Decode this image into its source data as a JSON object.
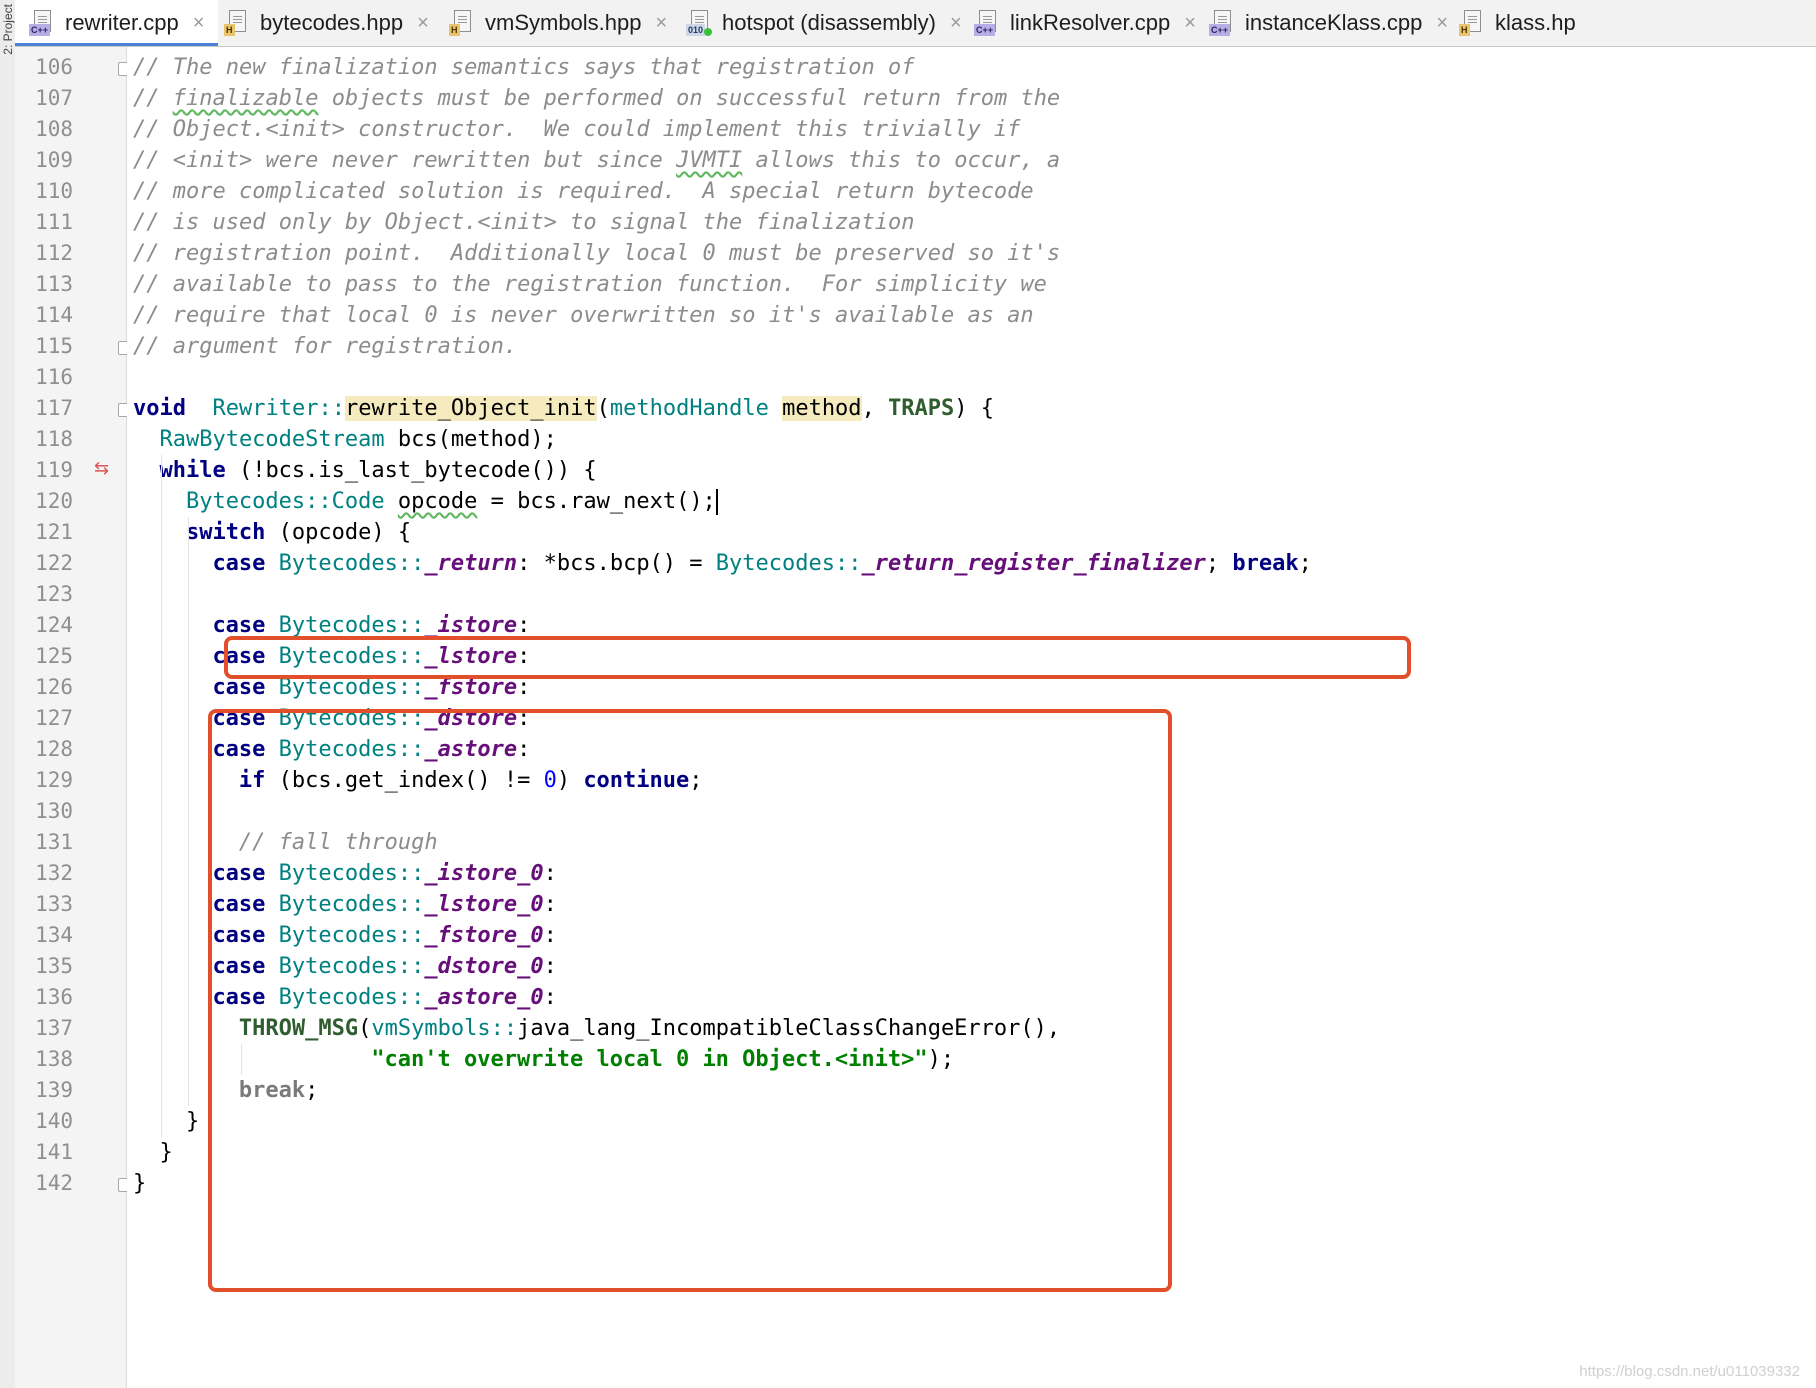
{
  "tabs": [
    {
      "label": "rewriter.cpp",
      "badge": "C++",
      "kind": "cpp",
      "active": true
    },
    {
      "label": "bytecodes.hpp",
      "badge": "H",
      "kind": "h"
    },
    {
      "label": "vmSymbols.hpp",
      "badge": "H",
      "kind": "h"
    },
    {
      "label": "hotspot (disassembly)",
      "badge": "010",
      "kind": "bin"
    },
    {
      "label": "linkResolver.cpp",
      "badge": "C++",
      "kind": "cpp"
    },
    {
      "label": "instanceKlass.cpp",
      "badge": "C++",
      "kind": "cpp"
    },
    {
      "label": "klass.hp",
      "badge": "H",
      "kind": "h"
    }
  ],
  "tab_close_glyph": "×",
  "side_label": "2: Project",
  "current_line": 120,
  "lines": [
    {
      "n": "106",
      "indent": 0,
      "t": [
        [
          "cm",
          "// The new finalization semantics says that registration of"
        ]
      ]
    },
    {
      "n": "107",
      "indent": 0,
      "t": [
        [
          "cm",
          "// "
        ],
        [
          "cm wavy",
          "finalizable"
        ],
        [
          "cm",
          " objects must be performed on successful return from the"
        ]
      ]
    },
    {
      "n": "108",
      "indent": 0,
      "t": [
        [
          "cm",
          "// Object.<init> constructor.  We could implement this trivially if"
        ]
      ]
    },
    {
      "n": "109",
      "indent": 0,
      "t": [
        [
          "cm",
          "// <init> were never rewritten but since "
        ],
        [
          "cm wavy",
          "JVMTI"
        ],
        [
          "cm",
          " allows this to occur, a"
        ]
      ]
    },
    {
      "n": "110",
      "indent": 0,
      "t": [
        [
          "cm",
          "// more complicated solution is required.  A special return bytecode"
        ]
      ]
    },
    {
      "n": "111",
      "indent": 0,
      "t": [
        [
          "cm",
          "// is used only by Object.<init> to signal the finalization"
        ]
      ]
    },
    {
      "n": "112",
      "indent": 0,
      "t": [
        [
          "cm",
          "// registration point.  Additionally local 0 must be preserved so it's"
        ]
      ]
    },
    {
      "n": "113",
      "indent": 0,
      "t": [
        [
          "cm",
          "// available to pass to the registration function.  For simplicity we"
        ]
      ]
    },
    {
      "n": "114",
      "indent": 0,
      "t": [
        [
          "cm",
          "// require that local 0 is never overwritten so it's available as an"
        ]
      ]
    },
    {
      "n": "115",
      "indent": 0,
      "t": [
        [
          "cm",
          "// argument for registration."
        ]
      ]
    },
    {
      "n": "116",
      "indent": 0,
      "t": []
    },
    {
      "n": "117",
      "indent": 0,
      "t": [
        [
          "kw",
          "void"
        ],
        [
          "",
          "  "
        ],
        [
          "ty",
          "Rewriter"
        ],
        [
          "ty",
          "::"
        ],
        [
          "fn",
          "rewrite_Object_init"
        ],
        [
          "",
          "("
        ],
        [
          "ty",
          "methodHandle"
        ],
        [
          "",
          " "
        ],
        [
          "paramhl",
          "method"
        ],
        [
          "",
          ", "
        ],
        [
          "mac",
          "TRAPS"
        ],
        [
          "",
          ") {"
        ]
      ]
    },
    {
      "n": "118",
      "indent": 2,
      "t": [
        [
          "ty",
          "RawBytecodeStream"
        ],
        [
          "",
          " bcs(method);"
        ]
      ]
    },
    {
      "n": "119",
      "indent": 2,
      "t": [
        [
          "kw",
          "while"
        ],
        [
          "",
          " (!bcs.is_last_bytecode()) {"
        ]
      ]
    },
    {
      "n": "120",
      "indent": 4,
      "t": [
        [
          "ty",
          "Bytecodes"
        ],
        [
          "ty",
          "::"
        ],
        [
          "ty",
          "Code"
        ],
        [
          "",
          " "
        ],
        [
          "wavy",
          "opcode"
        ],
        [
          "",
          " = bcs.raw_next();"
        ]
      ]
    },
    {
      "n": "121",
      "indent": 4,
      "t": [
        [
          "kw",
          "switch"
        ],
        [
          "",
          " (opcode) {"
        ]
      ]
    },
    {
      "n": "122",
      "indent": 6,
      "t": [
        [
          "kw",
          "case"
        ],
        [
          "",
          " "
        ],
        [
          "ty",
          "Bytecodes"
        ],
        [
          "ty",
          "::"
        ],
        [
          "en",
          "_return"
        ],
        [
          "",
          ": *bcs.bcp() = "
        ],
        [
          "ty",
          "Bytecodes"
        ],
        [
          "ty",
          "::"
        ],
        [
          "en",
          "_return_register_finalizer"
        ],
        [
          "",
          "; "
        ],
        [
          "kw",
          "break"
        ],
        [
          "",
          ";"
        ]
      ]
    },
    {
      "n": "123",
      "indent": 0,
      "t": []
    },
    {
      "n": "124",
      "indent": 6,
      "t": [
        [
          "kw",
          "case"
        ],
        [
          "",
          " "
        ],
        [
          "ty",
          "Bytecodes"
        ],
        [
          "ty",
          "::"
        ],
        [
          "en",
          "_istore"
        ],
        [
          "",
          ":"
        ]
      ]
    },
    {
      "n": "125",
      "indent": 6,
      "t": [
        [
          "kw",
          "case"
        ],
        [
          "",
          " "
        ],
        [
          "ty",
          "Bytecodes"
        ],
        [
          "ty",
          "::"
        ],
        [
          "en",
          "_lstore"
        ],
        [
          "",
          ":"
        ]
      ]
    },
    {
      "n": "126",
      "indent": 6,
      "t": [
        [
          "kw",
          "case"
        ],
        [
          "",
          " "
        ],
        [
          "ty",
          "Bytecodes"
        ],
        [
          "ty",
          "::"
        ],
        [
          "en",
          "_fstore"
        ],
        [
          "",
          ":"
        ]
      ]
    },
    {
      "n": "127",
      "indent": 6,
      "t": [
        [
          "kw",
          "case"
        ],
        [
          "",
          " "
        ],
        [
          "ty",
          "Bytecodes"
        ],
        [
          "ty",
          "::"
        ],
        [
          "en",
          "_dstore"
        ],
        [
          "",
          ":"
        ]
      ]
    },
    {
      "n": "128",
      "indent": 6,
      "t": [
        [
          "kw",
          "case"
        ],
        [
          "",
          " "
        ],
        [
          "ty",
          "Bytecodes"
        ],
        [
          "ty",
          "::"
        ],
        [
          "en",
          "_astore"
        ],
        [
          "",
          ":"
        ]
      ]
    },
    {
      "n": "129",
      "indent": 8,
      "t": [
        [
          "kw",
          "if"
        ],
        [
          "",
          " (bcs.get_index() != "
        ],
        [
          "num",
          "0"
        ],
        [
          "",
          ") "
        ],
        [
          "kw",
          "continue"
        ],
        [
          "",
          ";"
        ]
      ]
    },
    {
      "n": "130",
      "indent": 0,
      "t": []
    },
    {
      "n": "131",
      "indent": 8,
      "t": [
        [
          "cm",
          "// fall through"
        ]
      ]
    },
    {
      "n": "132",
      "indent": 6,
      "t": [
        [
          "kw",
          "case"
        ],
        [
          "",
          " "
        ],
        [
          "ty",
          "Bytecodes"
        ],
        [
          "ty",
          "::"
        ],
        [
          "en",
          "_istore_0"
        ],
        [
          "",
          ":"
        ]
      ]
    },
    {
      "n": "133",
      "indent": 6,
      "t": [
        [
          "kw",
          "case"
        ],
        [
          "",
          " "
        ],
        [
          "ty",
          "Bytecodes"
        ],
        [
          "ty",
          "::"
        ],
        [
          "en",
          "_lstore_0"
        ],
        [
          "",
          ":"
        ]
      ]
    },
    {
      "n": "134",
      "indent": 6,
      "t": [
        [
          "kw",
          "case"
        ],
        [
          "",
          " "
        ],
        [
          "ty",
          "Bytecodes"
        ],
        [
          "ty",
          "::"
        ],
        [
          "en",
          "_fstore_0"
        ],
        [
          "",
          ":"
        ]
      ]
    },
    {
      "n": "135",
      "indent": 6,
      "t": [
        [
          "kw",
          "case"
        ],
        [
          "",
          " "
        ],
        [
          "ty",
          "Bytecodes"
        ],
        [
          "ty",
          "::"
        ],
        [
          "en",
          "_dstore_0"
        ],
        [
          "",
          ":"
        ]
      ]
    },
    {
      "n": "136",
      "indent": 6,
      "t": [
        [
          "kw",
          "case"
        ],
        [
          "",
          " "
        ],
        [
          "ty",
          "Bytecodes"
        ],
        [
          "ty",
          "::"
        ],
        [
          "en",
          "_astore_0"
        ],
        [
          "",
          ":"
        ]
      ]
    },
    {
      "n": "137",
      "indent": 8,
      "t": [
        [
          "mac",
          "THROW_MSG"
        ],
        [
          "",
          "("
        ],
        [
          "ty",
          "vmSymbols"
        ],
        [
          "ty",
          "::"
        ],
        [
          "",
          "java_lang_IncompatibleClassChangeError(),"
        ]
      ]
    },
    {
      "n": "138",
      "indent": 18,
      "t": [
        [
          "str",
          "\"can't overwrite local 0 in Object.<init>\""
        ],
        [
          "",
          ");"
        ]
      ]
    },
    {
      "n": "139",
      "indent": 8,
      "t": [
        [
          "brk",
          "break"
        ],
        [
          "",
          ";"
        ]
      ]
    },
    {
      "n": "140",
      "indent": 4,
      "t": [
        [
          "",
          "}"
        ]
      ]
    },
    {
      "n": "141",
      "indent": 2,
      "t": [
        [
          "",
          "}"
        ]
      ]
    },
    {
      "n": "142",
      "indent": 0,
      "t": [
        [
          "",
          "}"
        ]
      ]
    }
  ],
  "watermark": "https://blog.csdn.net/u011039332"
}
